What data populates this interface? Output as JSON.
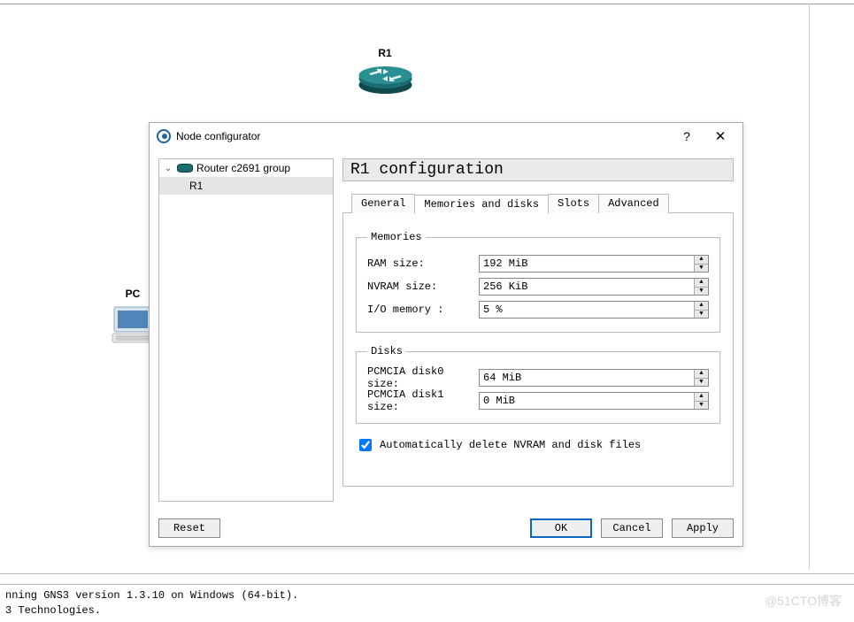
{
  "canvas": {
    "router_label": "R1",
    "pc_label": "PC"
  },
  "dialog": {
    "title": "Node configurator",
    "tree": {
      "group_label": "Router c2691 group",
      "child_label": "R1"
    },
    "panel_title": "R1 configuration",
    "tabs": {
      "general": "General",
      "memories": "Memories and disks",
      "slots": "Slots",
      "advanced": "Advanced"
    },
    "memories": {
      "legend": "Memories",
      "ram_label": "RAM size:",
      "ram_value": "192 MiB",
      "nvram_label": "NVRAM size:",
      "nvram_value": "256 KiB",
      "io_label": "I/O memory :",
      "io_value": "5 %"
    },
    "disks": {
      "legend": "Disks",
      "d0_label": "PCMCIA disk0 size:",
      "d0_value": "64 MiB",
      "d1_label": "PCMCIA disk1 size:",
      "d1_value": "0 MiB"
    },
    "auto_delete_label": "Automatically delete NVRAM and disk files",
    "buttons": {
      "reset": "Reset",
      "ok": "OK",
      "cancel": "Cancel",
      "apply": "Apply"
    }
  },
  "status": {
    "line1": "nning GNS3 version 1.3.10 on Windows (64-bit).",
    "line2": "3 Technologies."
  },
  "watermark": "@51CTO博客"
}
